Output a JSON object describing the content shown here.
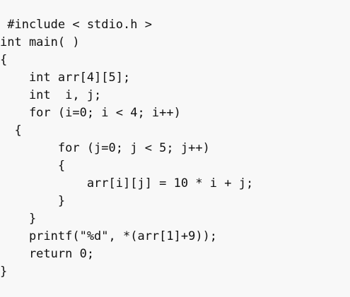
{
  "code": {
    "lines": [
      " #include < stdio.h >",
      "int main( )",
      "{",
      "    int arr[4][5];",
      "    int  i, j;",
      "    for (i=0; i < 4; i++)",
      "  {",
      "        for (j=0; j < 5; j++)",
      "        {",
      "            arr[i][j] = 10 * i + j;",
      "        }",
      "    }",
      "    printf(\"%d\", *(arr[1]+9));",
      "    return 0;",
      "}"
    ]
  }
}
